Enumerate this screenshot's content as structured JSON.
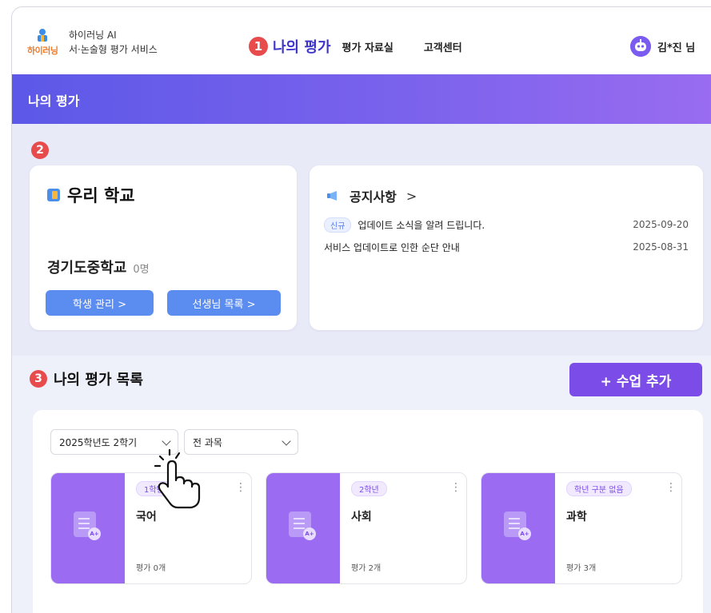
{
  "header": {
    "logo_word": "하이러닝",
    "brand_line1": "하이러닝 AI",
    "brand_line2": "서·논술형 평가 서비스",
    "nav_badge": "1",
    "nav_active": "나의 평가",
    "nav_items": [
      "평가 자료실",
      "고객센터"
    ],
    "user_name": "김*진 님"
  },
  "banner": {
    "title": "나의 평가"
  },
  "school_section": {
    "badge": "2",
    "school_card": {
      "title": "우리 학교",
      "school_name": "경기도중학교",
      "student_count": "0명",
      "buttons": [
        "학생 관리  >",
        "선생님 목록  >"
      ]
    },
    "notice_card": {
      "title": "공지사항",
      "chevron": ">",
      "items": [
        {
          "tag": "신규",
          "text": "업데이트 소식을 알려 드립니다.",
          "date": "2025-09-20"
        },
        {
          "tag": "",
          "text": "서비스 업데이트로 인한 순단 안내",
          "date": "2025-08-31"
        }
      ]
    }
  },
  "list_section": {
    "badge": "3",
    "title": "나의 평가 목록",
    "add_button": "+ 수업 추가",
    "filters": {
      "year": "2025학년도 2학기",
      "subject": "전 과목"
    },
    "classes": [
      {
        "grade": "1학년",
        "subject": "국어",
        "count": "평가 0개"
      },
      {
        "grade": "2학년",
        "subject": "사회",
        "count": "평가 2개"
      },
      {
        "grade": "학년 구분 없음",
        "subject": "과학",
        "count": "평가 3개"
      }
    ]
  },
  "colors": {
    "accent_purple": "#7b4ce8",
    "nav_active": "#3f35c8",
    "badge_red": "#e84b4b",
    "button_blue": "#5b8cf0",
    "banner_start": "#5d58e8",
    "banner_end": "#9a6cf0"
  },
  "icons": [
    "logo-icon",
    "robot-avatar-icon",
    "book-icon",
    "megaphone-icon",
    "chevron-down-icon",
    "more-vertical-icon",
    "document-icon",
    "pointer-hand-icon"
  ]
}
